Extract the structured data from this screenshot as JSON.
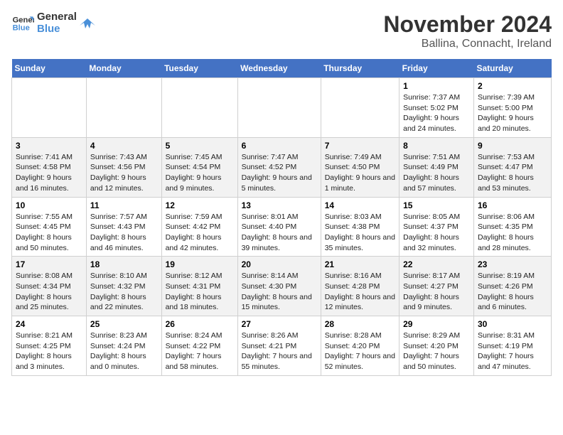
{
  "logo": {
    "line1": "General",
    "line2": "Blue"
  },
  "title": "November 2024",
  "subtitle": "Ballina, Connacht, Ireland",
  "weekdays": [
    "Sunday",
    "Monday",
    "Tuesday",
    "Wednesday",
    "Thursday",
    "Friday",
    "Saturday"
  ],
  "weeks": [
    [
      {
        "day": "",
        "info": ""
      },
      {
        "day": "",
        "info": ""
      },
      {
        "day": "",
        "info": ""
      },
      {
        "day": "",
        "info": ""
      },
      {
        "day": "",
        "info": ""
      },
      {
        "day": "1",
        "info": "Sunrise: 7:37 AM\nSunset: 5:02 PM\nDaylight: 9 hours and 24 minutes."
      },
      {
        "day": "2",
        "info": "Sunrise: 7:39 AM\nSunset: 5:00 PM\nDaylight: 9 hours and 20 minutes."
      }
    ],
    [
      {
        "day": "3",
        "info": "Sunrise: 7:41 AM\nSunset: 4:58 PM\nDaylight: 9 hours and 16 minutes."
      },
      {
        "day": "4",
        "info": "Sunrise: 7:43 AM\nSunset: 4:56 PM\nDaylight: 9 hours and 12 minutes."
      },
      {
        "day": "5",
        "info": "Sunrise: 7:45 AM\nSunset: 4:54 PM\nDaylight: 9 hours and 9 minutes."
      },
      {
        "day": "6",
        "info": "Sunrise: 7:47 AM\nSunset: 4:52 PM\nDaylight: 9 hours and 5 minutes."
      },
      {
        "day": "7",
        "info": "Sunrise: 7:49 AM\nSunset: 4:50 PM\nDaylight: 9 hours and 1 minute."
      },
      {
        "day": "8",
        "info": "Sunrise: 7:51 AM\nSunset: 4:49 PM\nDaylight: 8 hours and 57 minutes."
      },
      {
        "day": "9",
        "info": "Sunrise: 7:53 AM\nSunset: 4:47 PM\nDaylight: 8 hours and 53 minutes."
      }
    ],
    [
      {
        "day": "10",
        "info": "Sunrise: 7:55 AM\nSunset: 4:45 PM\nDaylight: 8 hours and 50 minutes."
      },
      {
        "day": "11",
        "info": "Sunrise: 7:57 AM\nSunset: 4:43 PM\nDaylight: 8 hours and 46 minutes."
      },
      {
        "day": "12",
        "info": "Sunrise: 7:59 AM\nSunset: 4:42 PM\nDaylight: 8 hours and 42 minutes."
      },
      {
        "day": "13",
        "info": "Sunrise: 8:01 AM\nSunset: 4:40 PM\nDaylight: 8 hours and 39 minutes."
      },
      {
        "day": "14",
        "info": "Sunrise: 8:03 AM\nSunset: 4:38 PM\nDaylight: 8 hours and 35 minutes."
      },
      {
        "day": "15",
        "info": "Sunrise: 8:05 AM\nSunset: 4:37 PM\nDaylight: 8 hours and 32 minutes."
      },
      {
        "day": "16",
        "info": "Sunrise: 8:06 AM\nSunset: 4:35 PM\nDaylight: 8 hours and 28 minutes."
      }
    ],
    [
      {
        "day": "17",
        "info": "Sunrise: 8:08 AM\nSunset: 4:34 PM\nDaylight: 8 hours and 25 minutes."
      },
      {
        "day": "18",
        "info": "Sunrise: 8:10 AM\nSunset: 4:32 PM\nDaylight: 8 hours and 22 minutes."
      },
      {
        "day": "19",
        "info": "Sunrise: 8:12 AM\nSunset: 4:31 PM\nDaylight: 8 hours and 18 minutes."
      },
      {
        "day": "20",
        "info": "Sunrise: 8:14 AM\nSunset: 4:30 PM\nDaylight: 8 hours and 15 minutes."
      },
      {
        "day": "21",
        "info": "Sunrise: 8:16 AM\nSunset: 4:28 PM\nDaylight: 8 hours and 12 minutes."
      },
      {
        "day": "22",
        "info": "Sunrise: 8:17 AM\nSunset: 4:27 PM\nDaylight: 8 hours and 9 minutes."
      },
      {
        "day": "23",
        "info": "Sunrise: 8:19 AM\nSunset: 4:26 PM\nDaylight: 8 hours and 6 minutes."
      }
    ],
    [
      {
        "day": "24",
        "info": "Sunrise: 8:21 AM\nSunset: 4:25 PM\nDaylight: 8 hours and 3 minutes."
      },
      {
        "day": "25",
        "info": "Sunrise: 8:23 AM\nSunset: 4:24 PM\nDaylight: 8 hours and 0 minutes."
      },
      {
        "day": "26",
        "info": "Sunrise: 8:24 AM\nSunset: 4:22 PM\nDaylight: 7 hours and 58 minutes."
      },
      {
        "day": "27",
        "info": "Sunrise: 8:26 AM\nSunset: 4:21 PM\nDaylight: 7 hours and 55 minutes."
      },
      {
        "day": "28",
        "info": "Sunrise: 8:28 AM\nSunset: 4:20 PM\nDaylight: 7 hours and 52 minutes."
      },
      {
        "day": "29",
        "info": "Sunrise: 8:29 AM\nSunset: 4:20 PM\nDaylight: 7 hours and 50 minutes."
      },
      {
        "day": "30",
        "info": "Sunrise: 8:31 AM\nSunset: 4:19 PM\nDaylight: 7 hours and 47 minutes."
      }
    ]
  ]
}
